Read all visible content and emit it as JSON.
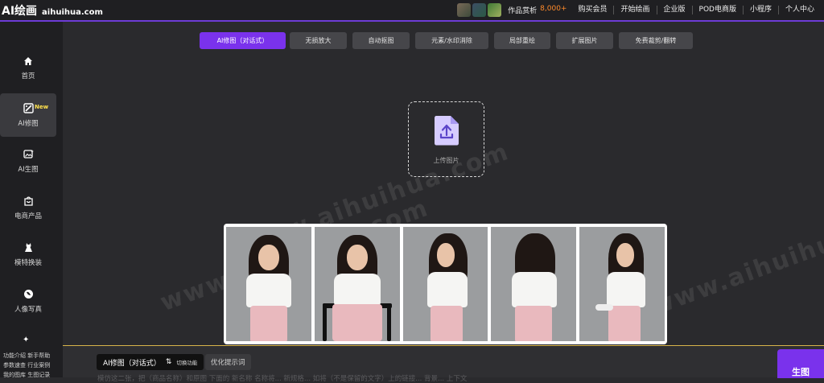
{
  "header": {
    "logo_text": "AI绘画",
    "logo_domain": "aihuihua.com",
    "appreciate_label": "作品赏析",
    "appreciate_count": "8,000+",
    "nav": [
      "购买会员",
      "开始绘画",
      "企业版",
      "POD电商版",
      "小程序",
      "个人中心"
    ]
  },
  "sidebar": {
    "items": [
      {
        "label": "首页",
        "icon": "home-icon"
      },
      {
        "label": "AI修图",
        "icon": "image-edit-icon",
        "badge": "New"
      },
      {
        "label": "AI生图",
        "icon": "image-generate-icon"
      },
      {
        "label": "电商产品",
        "icon": "shopping-bag-icon"
      },
      {
        "label": "模特换装",
        "icon": "dress-icon"
      },
      {
        "label": "人像写真",
        "icon": "portrait-icon"
      }
    ],
    "footer_links": [
      "功能介绍",
      "新手帮助",
      "参数速查",
      "行业案例",
      "我的图库",
      "生图记录"
    ]
  },
  "tabs": [
    "AI修图（对话式）",
    "无损放大",
    "自动抠图",
    "元素/水印消除",
    "局部重绘",
    "扩展图片",
    "免费裁剪/翻转"
  ],
  "upload": {
    "label": "上传图片"
  },
  "watermark": "www.aihuihua.com",
  "bottom": {
    "mode_label": "AI修图（对话式）",
    "switch_label": "切换功能",
    "optimize_label": "优化提示词",
    "prompt_hint": "模仿这二张，把（商品名称）和原图 下面的 新名称 名称将... 新规格... 如将（不是保留的文字）上的链接... 背景... 上下文",
    "generate_label": "生图"
  },
  "colors": {
    "accent": "#7a32ec",
    "highlight": "#ff8a2a",
    "badge": "#ffe14d"
  }
}
